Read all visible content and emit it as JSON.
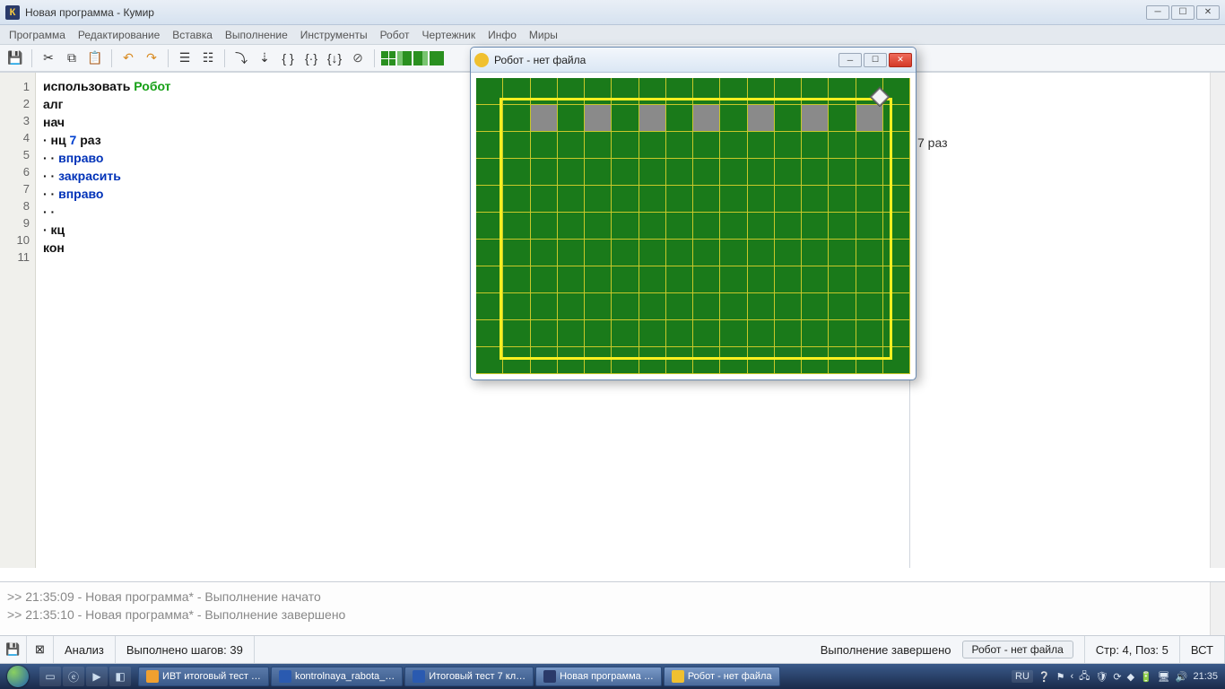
{
  "titlebar": {
    "app_letter": "К",
    "title": "Новая программа - Кумир"
  },
  "menu": {
    "items": [
      "Программа",
      "Редактирование",
      "Вставка",
      "Выполнение",
      "Инструменты",
      "Робот",
      "Чертежник",
      "Инфо",
      "Миры"
    ]
  },
  "code": {
    "lines": [
      "1",
      "2",
      "3",
      "4",
      "5",
      "6",
      "7",
      "8",
      "9",
      "10",
      "11"
    ],
    "l1_use": "использовать ",
    "l1_robot": "Робот",
    "l2": "алг",
    "l3": "нач",
    "l4_pre": "· нц ",
    "l4_num": "7",
    "l4_post": " раз",
    "l5": "· · вправо",
    "l6": "· · закрасить",
    "l7": "· · вправо",
    "l8": "· ·",
    "l9": "· кц",
    "l10": "кон"
  },
  "right_pane": {
    "text": "7  раз"
  },
  "robot_window": {
    "title": "Робот - нет файла"
  },
  "console": {
    "line1": ">> 21:35:09 - Новая программа* - Выполнение начато",
    "line2": ">> 21:35:10 - Новая программа* - Выполнение завершено"
  },
  "status": {
    "analysis": "Анализ",
    "steps": "Выполнено шагов: 39",
    "exec": "Выполнение завершено",
    "robot_tag": "Робот - нет файла",
    "cursor": "Стр: 4, Поз: 5",
    "mode": "ВСТ"
  },
  "taskbar": {
    "items": [
      "ИВТ итоговый тест …",
      "kontrolnaya_rabota_…",
      "Итоговый тест 7 кл…",
      "Новая программа …",
      "Робот - нет файла"
    ],
    "lang": "RU",
    "clock": "21:35"
  }
}
